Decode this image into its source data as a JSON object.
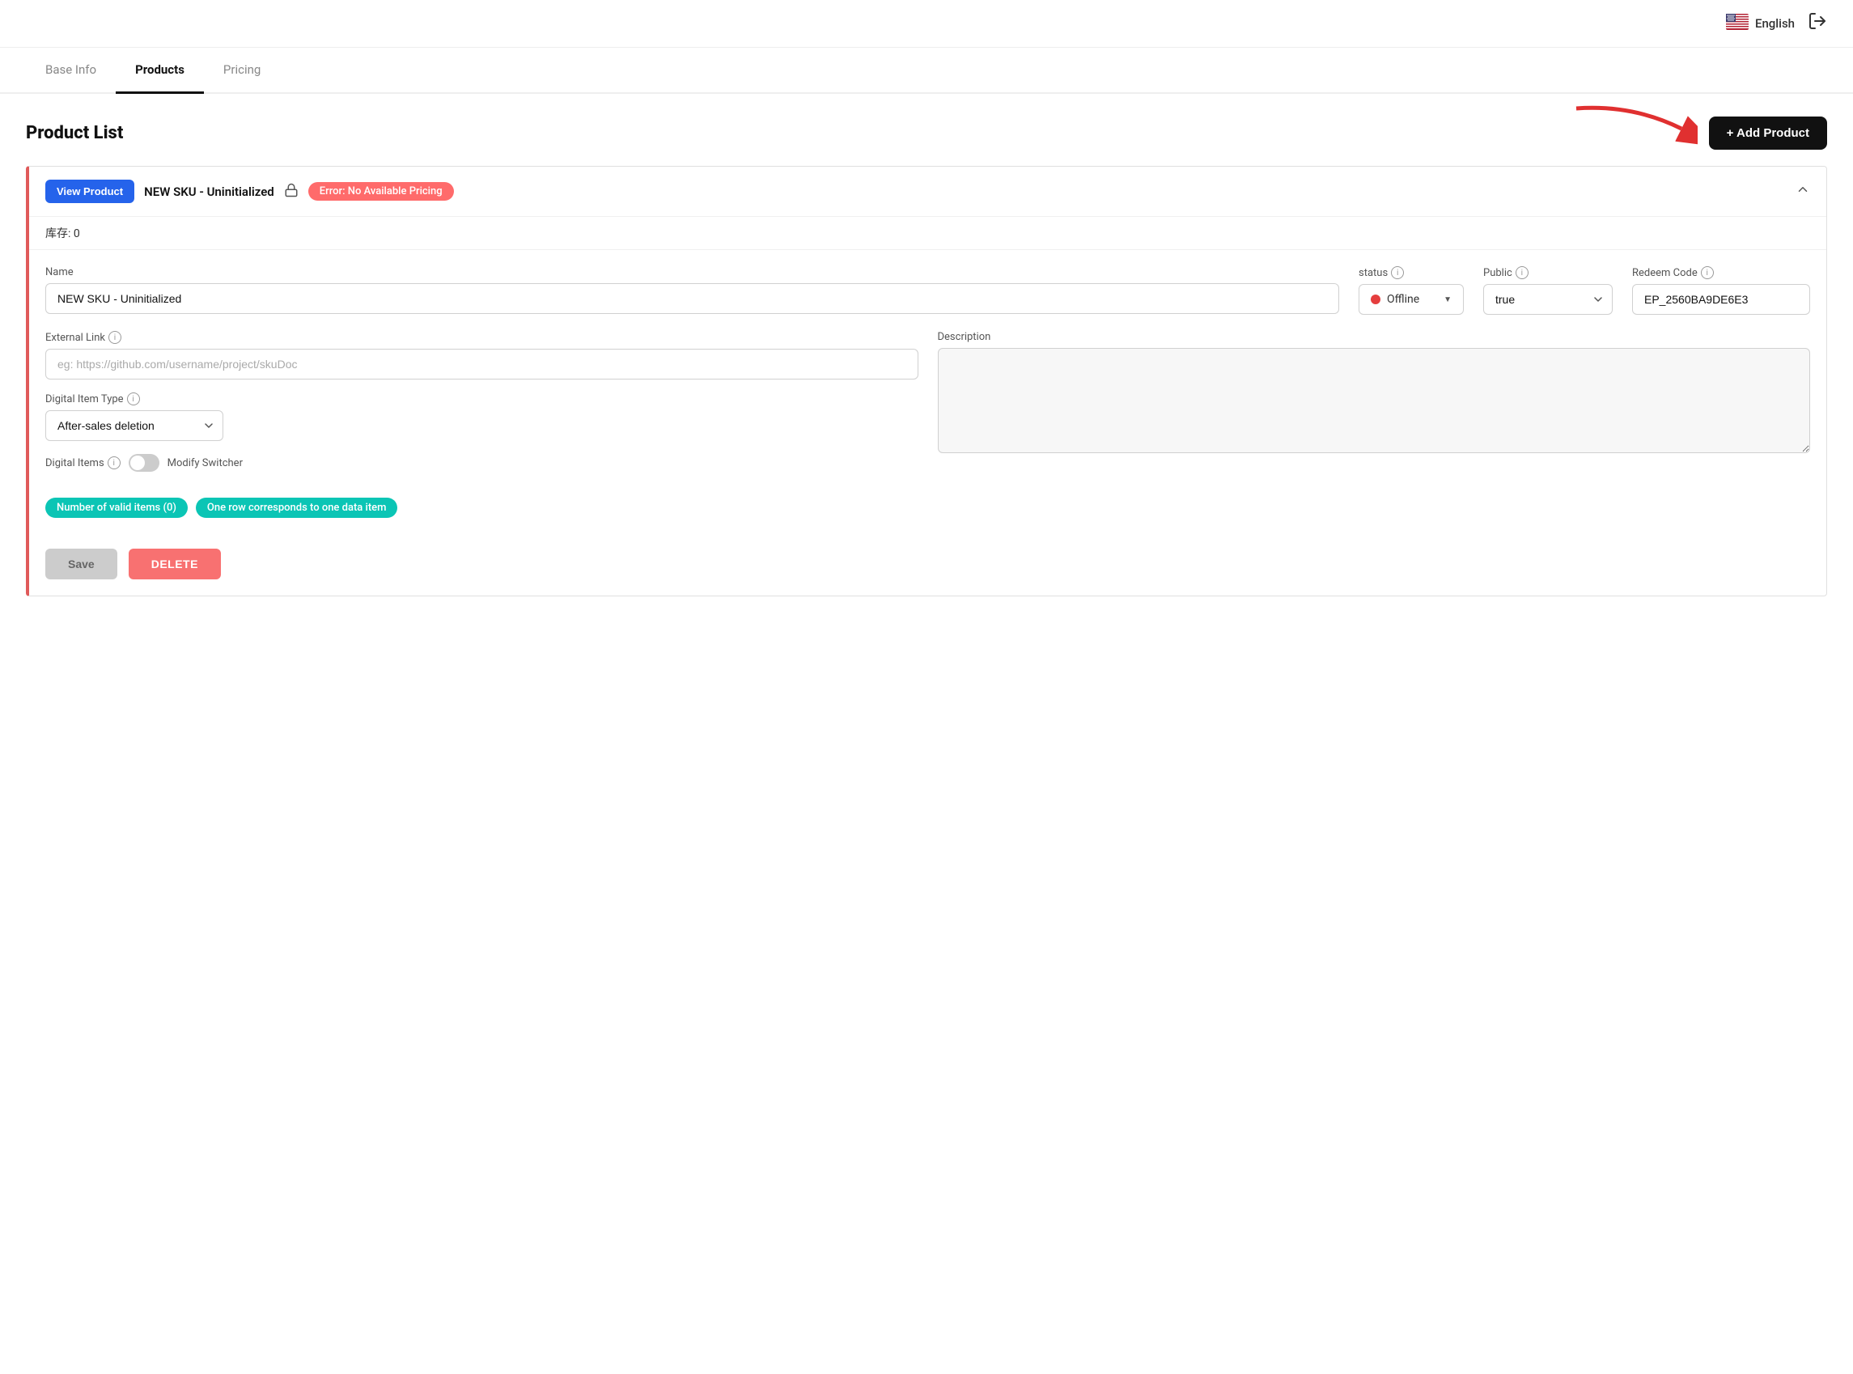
{
  "header": {
    "language": "English",
    "logout_title": "Logout"
  },
  "tabs": [
    {
      "id": "base-info",
      "label": "Base Info",
      "active": false
    },
    {
      "id": "products",
      "label": "Products",
      "active": true
    },
    {
      "id": "pricing",
      "label": "Pricing",
      "active": false
    }
  ],
  "main": {
    "title": "Product List",
    "add_button": "+ Add Product",
    "product": {
      "view_btn": "View Product",
      "sku_name": "NEW SKU - Uninitialized",
      "error_badge": "Error: No Available Pricing",
      "inventory_label": "库存: 0",
      "fields": {
        "name_label": "Name",
        "name_value": "NEW SKU - Uninitialized",
        "status_label": "status",
        "status_value": "Offline",
        "public_label": "Public",
        "public_value": "true",
        "redeem_code_label": "Redeem Code",
        "redeem_code_value": "EP_2560BA9DE6E3",
        "external_link_label": "External Link",
        "external_link_placeholder": "eg: https://github.com/username/project/skuDoc",
        "description_label": "Description",
        "description_value": "",
        "digital_item_type_label": "Digital Item Type",
        "digital_item_type_value": "After-sales deletion",
        "digital_items_label": "Digital Items",
        "modify_switcher_label": "Modify Switcher",
        "tag1": "Number of valid items (0)",
        "tag2": "One row corresponds to one data item"
      },
      "save_btn": "Save",
      "delete_btn": "DELETE"
    }
  }
}
